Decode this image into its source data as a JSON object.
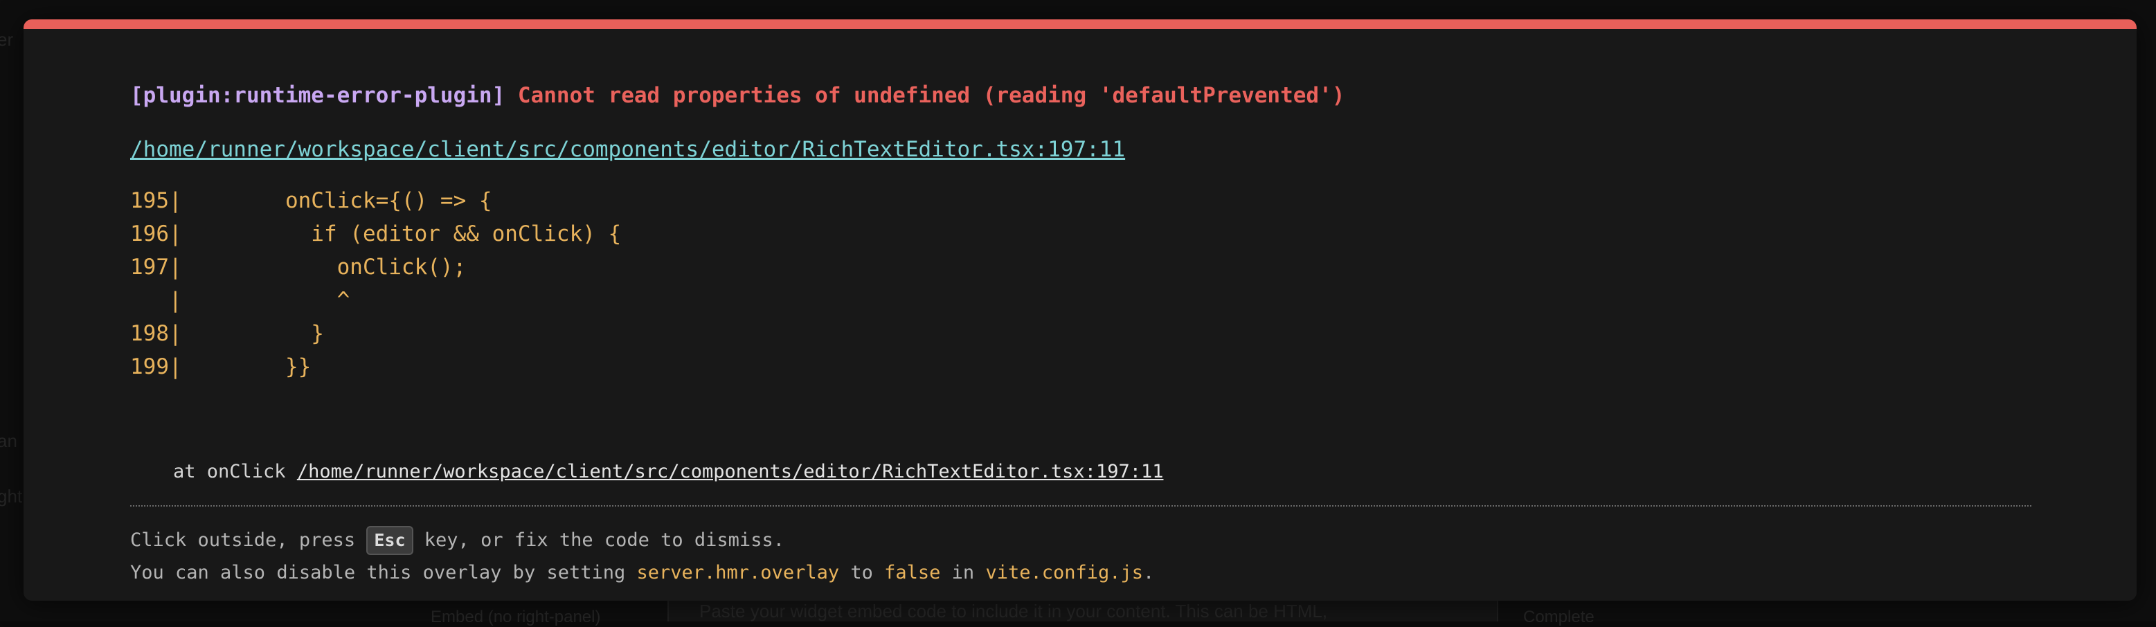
{
  "background": {
    "texts": [
      {
        "name": "bg-text-left-1",
        "text": "er"
      },
      {
        "name": "bg-text-left-2",
        "text": "an"
      },
      {
        "name": "bg-text-left-3",
        "text": "ght"
      },
      {
        "name": "bg-text-bottom-1",
        "text": "Embed (no right-panel)"
      },
      {
        "name": "bg-text-bottom-2",
        "text": "Paste your widget embed code to include it in your content. This can be HTML,"
      },
      {
        "name": "bg-text-bottom-3",
        "text": "Complete"
      }
    ]
  },
  "error": {
    "plugin": "[plugin:runtime-error-plugin]",
    "message": "Cannot read properties of undefined (reading 'defaultPrevented')",
    "file": "/home/runner/workspace/client/src/components/editor/RichTextEditor.tsx:197:11"
  },
  "frame": [
    {
      "line": "195|",
      "code": "        onClick={() => {"
    },
    {
      "line": "196|",
      "code": "          if (editor && onClick) {"
    },
    {
      "line": "197|",
      "code": "            onClick();"
    },
    {
      "line": "   |",
      "code": "            ^"
    },
    {
      "line": "198|",
      "code": "          }"
    },
    {
      "line": "199|",
      "code": "        }}"
    }
  ],
  "stack": {
    "prefix": "at onClick ",
    "link": "/home/runner/workspace/client/src/components/editor/RichTextEditor.tsx:197:11"
  },
  "tip": {
    "line1_a": "Click outside, press ",
    "key": "Esc",
    "line1_b": " key, or fix the code to dismiss.",
    "line2_a": "You can also disable this overlay by setting ",
    "code1": "server.hmr.overlay",
    "line2_b": " to ",
    "code2": "false",
    "line2_c": " in ",
    "code3": "vite.config.js",
    "line2_d": "."
  },
  "colors": {
    "accent_bar": "#e9605a",
    "plugin": "#c9a8f2",
    "error": "#ea625c",
    "link": "#7ed3d6",
    "code": "#e8b35c",
    "overlay_bg": "#181818"
  }
}
